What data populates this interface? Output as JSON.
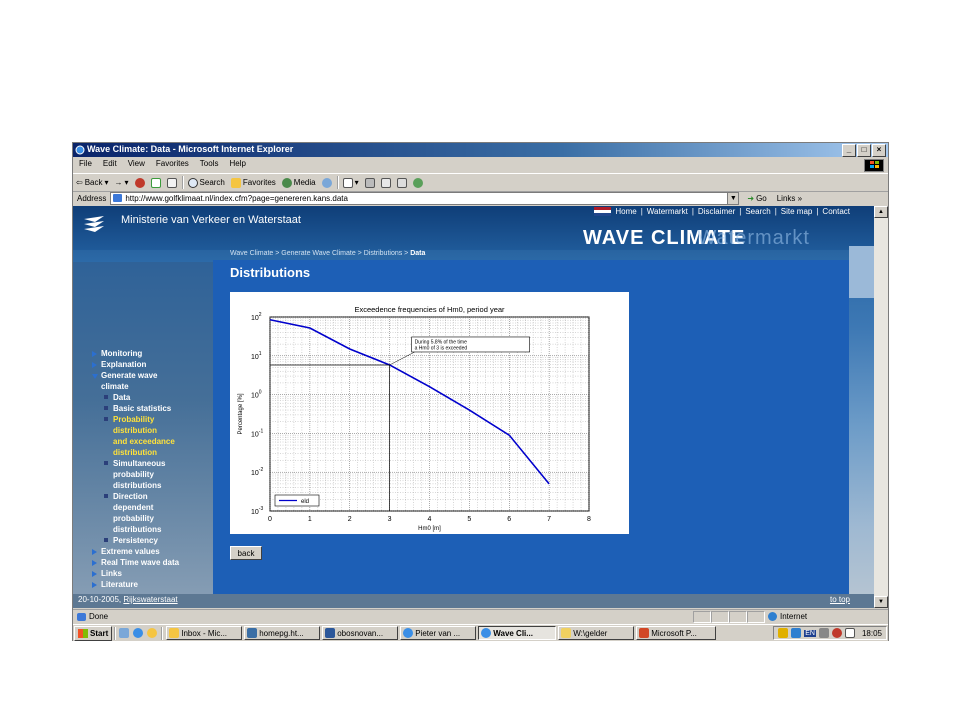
{
  "window": {
    "title": "Wave Climate: Data - Microsoft Internet Explorer",
    "controls": [
      "_",
      "□",
      "×"
    ]
  },
  "menu": [
    "File",
    "Edit",
    "View",
    "Favorites",
    "Tools",
    "Help"
  ],
  "toolbar": {
    "back": "Back",
    "forward": "→",
    "search": "Search",
    "favorites": "Favorites",
    "media": "Media"
  },
  "address": {
    "label": "Address",
    "url": "http://www.golfklimaat.nl/index.cfm?page=genereren.kans.data",
    "go": "Go",
    "links": "Links",
    "links_more": "»"
  },
  "site": {
    "ministry": "Ministerie van Verkeer en Waterstaat",
    "topnav": [
      "Home",
      "Watermarkt",
      "Disclaimer",
      "Search",
      "Site map",
      "Contact"
    ],
    "topnav_sep": "|",
    "wave_title": "WAVE CLIMATE",
    "wave_ghost": "Watermarkt",
    "breadcrumb": [
      "Wave Climate",
      "Generate Wave Climate",
      "Distributions"
    ],
    "breadcrumb_current": "Data",
    "breadcrumb_sep": " > ",
    "page_title": "Distributions",
    "back_button": "back",
    "footer_date": "20-10-2005, ",
    "footer_link": "Rijkswaterstaat",
    "to_top": "to top"
  },
  "nav": {
    "monitoring": "Monitoring",
    "explanation": "Explanation",
    "generate": [
      "Generate wave",
      "climate"
    ],
    "data": "Data",
    "basic": "Basic statistics",
    "probability": [
      "Probability",
      "distribution",
      "and exceedance",
      "distribution"
    ],
    "simultaneous": [
      "Simultaneous",
      "probability",
      "distributions"
    ],
    "direction": [
      "Direction",
      "dependent",
      "probability",
      "distributions"
    ],
    "persistency": "Persistency",
    "extreme": "Extreme values",
    "realtime": "Real Time wave data",
    "links": "Links",
    "literature": "Literature"
  },
  "chart_data": {
    "type": "line",
    "title": "Exceedence frequencies of Hm0, period year",
    "xlabel": "Hm0 [m]",
    "ylabel": "Percentage [%]",
    "xlim": [
      0,
      8
    ],
    "ylim": [
      0.001,
      100
    ],
    "yscale": "log",
    "x_ticks": [
      "0",
      "1",
      "2",
      "3",
      "4",
      "5",
      "6",
      "7",
      "8"
    ],
    "y_tick_exponents": [
      "2",
      "1",
      "0",
      "-1",
      "-2",
      "-3"
    ],
    "y_tick_base": "10",
    "grid": true,
    "legend_position": "bottom-left",
    "series": [
      {
        "name": "eld",
        "color": "#0000cc",
        "x": [
          0,
          1,
          2,
          3,
          4,
          5,
          6,
          7
        ],
        "y": [
          85,
          52,
          15,
          5.8,
          1.6,
          0.4,
          0.09,
          0.005
        ]
      }
    ],
    "annotation": {
      "lines": [
        "During 5.8% of the time",
        "a Hm0 of 3 is exceeded"
      ],
      "x": 3,
      "y": 5.8
    }
  },
  "statusbar": {
    "status": "Done",
    "zone": "Internet"
  },
  "taskbar": {
    "start": "Start",
    "items": [
      "Inbox - Mic...",
      "homepg.ht...",
      "obosnovan...",
      "Pieter van ...",
      "Wave Cli...",
      "W:\\gelder",
      "Microsoft P..."
    ],
    "active_index": 4,
    "tray_lang": "EN",
    "clock": "18:05"
  },
  "colors": {
    "site_blue": "#1d5fb6",
    "nav_active": "#ffe23a",
    "title_bar": "#0a246a"
  }
}
